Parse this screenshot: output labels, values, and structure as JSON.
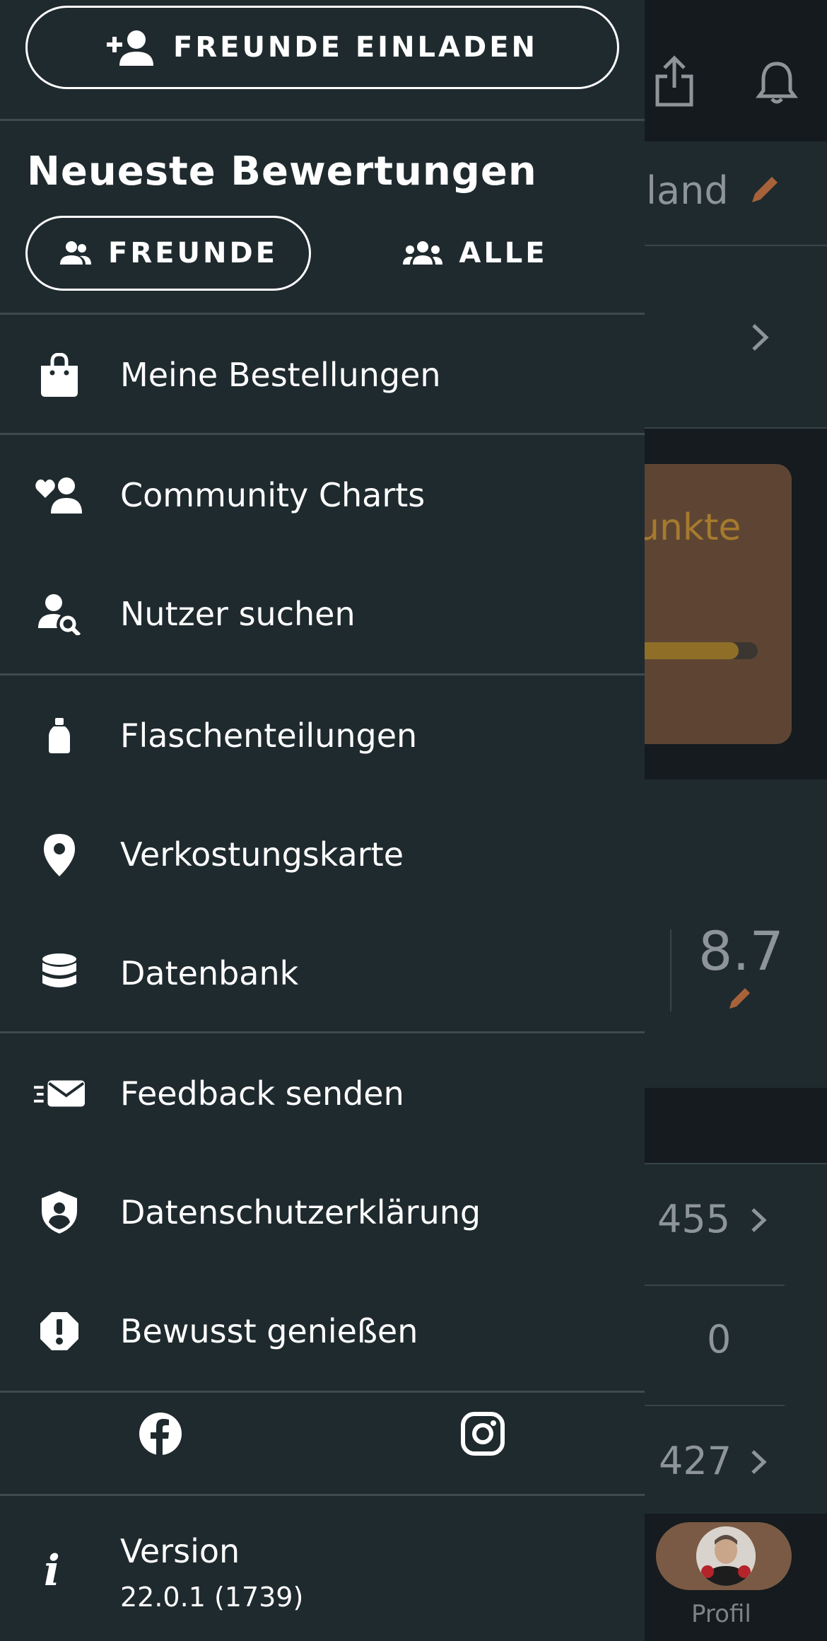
{
  "drawer": {
    "invite_label": "FREUNDE EINLADEN",
    "section_title": "Neueste Bewertungen",
    "seg_friends": "FREUNDE",
    "seg_all": "ALLE",
    "menu": [
      {
        "label": "Meine Bestellungen",
        "icon": "shopping-bag-icon"
      },
      {
        "label": "Community Charts",
        "icon": "community-heart-icon"
      },
      {
        "label": "Nutzer suchen",
        "icon": "user-search-icon"
      },
      {
        "label": "Flaschenteilungen",
        "icon": "bottle-icon"
      },
      {
        "label": "Verkostungskarte",
        "icon": "map-pin-icon"
      },
      {
        "label": "Datenbank",
        "icon": "database-icon"
      },
      {
        "label": "Feedback senden",
        "icon": "send-mail-icon"
      },
      {
        "label": "Datenschutzerklärung",
        "icon": "privacy-shield-icon"
      },
      {
        "label": "Bewusst genießen",
        "icon": "alert-icon"
      }
    ],
    "social": [
      "facebook-icon",
      "instagram-icon"
    ],
    "version_label": "Version",
    "version_value": "22.0.1 (1739)"
  },
  "background": {
    "title_fragment": "land",
    "card_title_fragment": "unkte",
    "card_progress": 0.86,
    "score": "8.7",
    "stat_1": "455",
    "stat_2": "0",
    "stat_3": "427",
    "nav_profile": "Profil"
  },
  "colors": {
    "drawer_bg": "#1f2a2e",
    "divider": "#3e4a4f",
    "accent_brown": "#a8623a",
    "card_bg": "#5e4533"
  }
}
